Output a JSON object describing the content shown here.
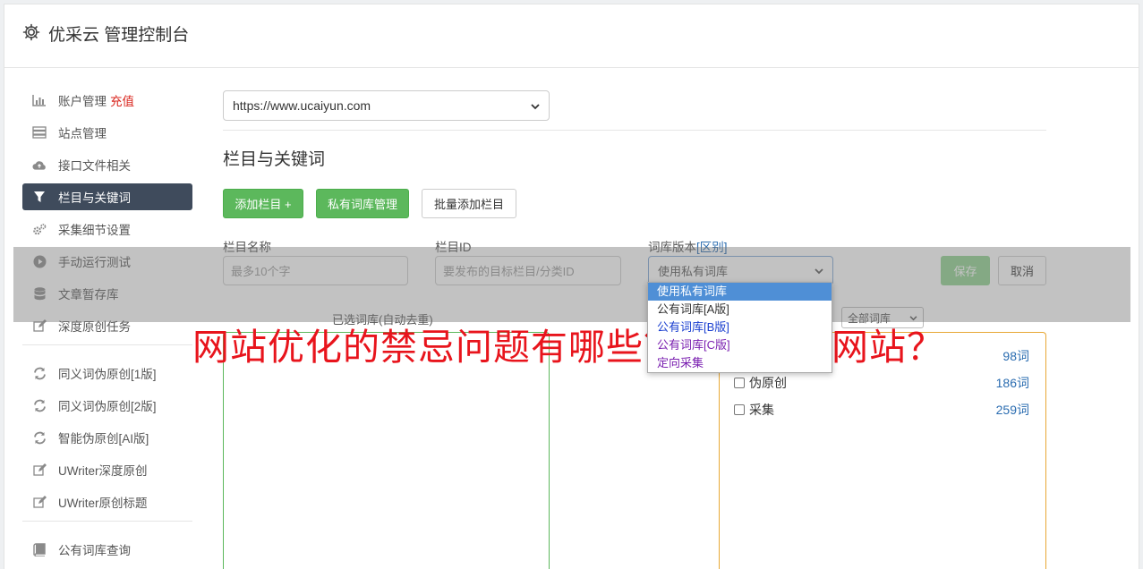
{
  "header": {
    "title": "优采云 管理控制台"
  },
  "sidebar": {
    "items": [
      {
        "label": "账户管理",
        "badge": "充值",
        "icon": "bar-chart-icon"
      },
      {
        "label": "站点管理",
        "icon": "server-icon"
      },
      {
        "label": "接口文件相关",
        "icon": "cloud-upload-icon"
      },
      {
        "label": "栏目与关键词",
        "icon": "filter-icon",
        "active": true
      },
      {
        "label": "采集细节设置",
        "icon": "cogs-icon"
      },
      {
        "label": "手动运行测试",
        "icon": "play-circle-icon"
      },
      {
        "label": "文章暂存库",
        "icon": "database-icon"
      },
      {
        "label": "深度原创任务",
        "icon": "edit-icon"
      }
    ],
    "items2": [
      {
        "label": "同义词伪原创[1版]",
        "icon": "refresh-icon"
      },
      {
        "label": "同义词伪原创[2版]",
        "icon": "refresh-icon"
      },
      {
        "label": "智能伪原创[AI版]",
        "icon": "refresh-icon"
      },
      {
        "label": "UWriter深度原创",
        "icon": "edit-icon"
      },
      {
        "label": "UWriter原创标题",
        "icon": "edit-icon"
      }
    ],
    "items3": [
      {
        "label": "公有词库查询",
        "icon": "book-icon"
      }
    ]
  },
  "main": {
    "site_select": "https://www.ucaiyun.com",
    "section_title": "栏目与关键词",
    "buttons": {
      "add_column": "添加栏目 +",
      "private_lib": "私有词库管理",
      "batch_add": "批量添加栏目"
    },
    "form": {
      "name_label": "栏目名称",
      "name_placeholder": "最多10个字",
      "id_label": "栏目ID",
      "id_placeholder": "要发布的目标栏目/分类ID",
      "version_label": "词库版本",
      "version_link": "[区别]",
      "version_value": "使用私有词库",
      "save": "保存",
      "cancel": "取消"
    },
    "selected_caption": "已选词库(自动去重)",
    "filter_value": "全部词库",
    "libraries": [
      {
        "name": "",
        "count": "98词"
      },
      {
        "name": "伪原创",
        "count": "186词"
      },
      {
        "name": "采集",
        "count": "259词"
      }
    ],
    "dropdown_options": [
      "使用私有词库",
      "公有词库[A版]",
      "公有词库[B版]",
      "公有词库[C版]",
      "定向采集"
    ]
  },
  "watermark": "网站优化的禁忌问题有哪些？怎么做好网站？",
  "colors": {
    "primary_green": "#5cb85c",
    "active_nav": "#3f4b5c",
    "recharge_red": "#d9251d",
    "link_blue": "#2a6cb0",
    "watermark_red": "#e8141c"
  }
}
